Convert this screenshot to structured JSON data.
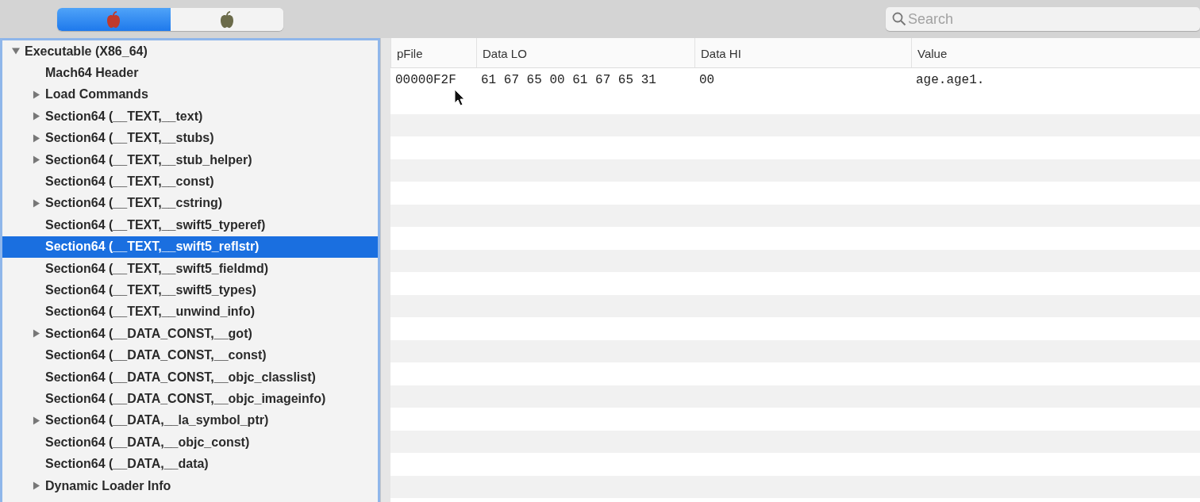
{
  "segments": [
    {
      "selected": true,
      "color": "#c0392b"
    },
    {
      "selected": false,
      "color": "#6b6b4a"
    }
  ],
  "search": {
    "placeholder": "Search"
  },
  "tree": [
    {
      "label": "Executable  (X86_64)",
      "kind": "folder",
      "expanded": true,
      "selected": false,
      "children": [
        {
          "label": "Mach64 Header",
          "kind": "leaf",
          "selected": false
        },
        {
          "label": "Load Commands",
          "kind": "folder",
          "expanded": false,
          "selected": false
        },
        {
          "label": "Section64 (__TEXT,__text)",
          "kind": "folder",
          "expanded": false,
          "selected": false
        },
        {
          "label": "Section64 (__TEXT,__stubs)",
          "kind": "folder",
          "expanded": false,
          "selected": false
        },
        {
          "label": "Section64 (__TEXT,__stub_helper)",
          "kind": "folder",
          "expanded": false,
          "selected": false
        },
        {
          "label": "Section64 (__TEXT,__const)",
          "kind": "leaf",
          "selected": false
        },
        {
          "label": "Section64 (__TEXT,__cstring)",
          "kind": "folder",
          "expanded": false,
          "selected": false
        },
        {
          "label": "Section64 (__TEXT,__swift5_typeref)",
          "kind": "leaf",
          "selected": false
        },
        {
          "label": "Section64 (__TEXT,__swift5_reflstr)",
          "kind": "leaf",
          "selected": true
        },
        {
          "label": "Section64 (__TEXT,__swift5_fieldmd)",
          "kind": "leaf",
          "selected": false
        },
        {
          "label": "Section64 (__TEXT,__swift5_types)",
          "kind": "leaf",
          "selected": false
        },
        {
          "label": "Section64 (__TEXT,__unwind_info)",
          "kind": "leaf",
          "selected": false
        },
        {
          "label": "Section64 (__DATA_CONST,__got)",
          "kind": "folder",
          "expanded": false,
          "selected": false
        },
        {
          "label": "Section64 (__DATA_CONST,__const)",
          "kind": "leaf",
          "selected": false
        },
        {
          "label": "Section64 (__DATA_CONST,__objc_classlist)",
          "kind": "leaf",
          "selected": false
        },
        {
          "label": "Section64 (__DATA_CONST,__objc_imageinfo)",
          "kind": "leaf",
          "selected": false
        },
        {
          "label": "Section64 (__DATA,__la_symbol_ptr)",
          "kind": "folder",
          "expanded": false,
          "selected": false
        },
        {
          "label": "Section64 (__DATA,__objc_const)",
          "kind": "leaf",
          "selected": false
        },
        {
          "label": "Section64 (__DATA,__data)",
          "kind": "leaf",
          "selected": false
        },
        {
          "label": "Dynamic Loader Info",
          "kind": "folder",
          "expanded": false,
          "selected": false
        }
      ]
    }
  ],
  "table": {
    "columns": [
      "pFile",
      "Data LO",
      "Data HI",
      "Value"
    ],
    "rows": [
      [
        "00000F2F",
        "61 67 65 00 61 67 65 31",
        "00",
        "age.age1."
      ]
    ]
  }
}
